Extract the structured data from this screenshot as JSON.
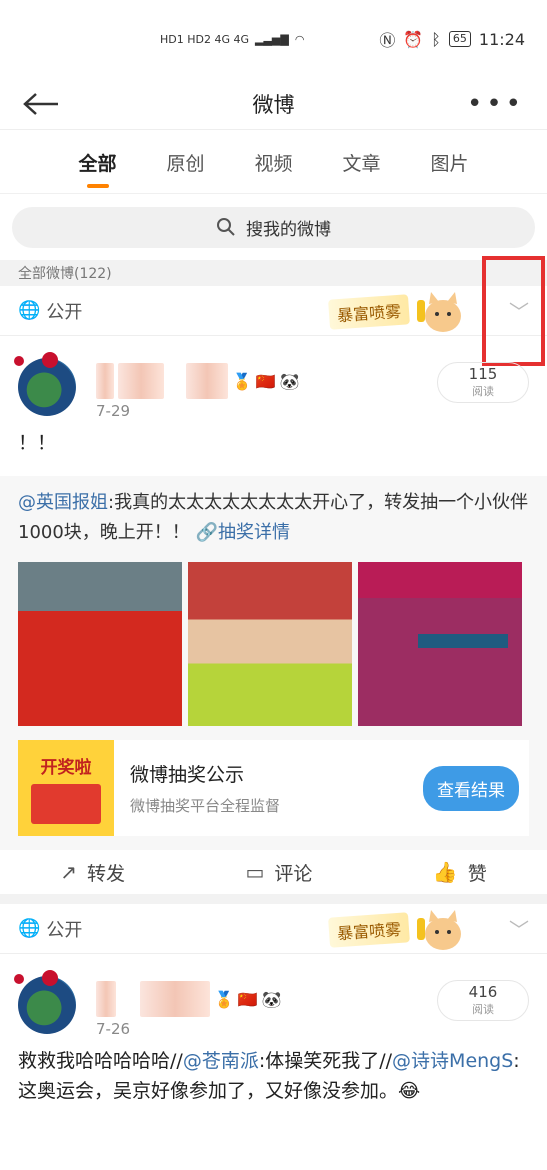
{
  "status": {
    "left": "HD1 HD2 4G 4G",
    "time": "11:24",
    "battery": "65"
  },
  "header": {
    "title": "微博"
  },
  "tabs": [
    {
      "label": "全部",
      "active": true
    },
    {
      "label": "原创"
    },
    {
      "label": "视频"
    },
    {
      "label": "文章"
    },
    {
      "label": "图片"
    }
  ],
  "search": {
    "placeholder": "搜我的微博"
  },
  "section": {
    "label": "全部微博(122)"
  },
  "filter": {
    "label": "公开",
    "banner": "暴富喷雾"
  },
  "posts": [
    {
      "date": "7-29",
      "views": "115",
      "views_label": "阅读",
      "text": "！！",
      "repost": {
        "mention": "@英国报姐",
        "text": ":我真的太太太太太太太太开心了，转发抽一个小伙伴1000块，晚上开！！",
        "link": "🔗抽奖详情"
      },
      "card": {
        "thumb_text": "开奖啦",
        "title": "微博抽奖公示",
        "subtitle": "微博抽奖平台全程监督",
        "button": "查看结果"
      }
    },
    {
      "date": "7-26",
      "views": "416",
      "views_label": "阅读",
      "text_parts": [
        "救救我哈哈哈哈哈//",
        "@苍南派",
        ":体操笑死我了//",
        "@诗诗MengS",
        ":这奥运会，吴京好像参加了，又好像没参加。😂"
      ]
    }
  ],
  "actions": {
    "repost": "转发",
    "comment": "评论",
    "like": "赞"
  }
}
